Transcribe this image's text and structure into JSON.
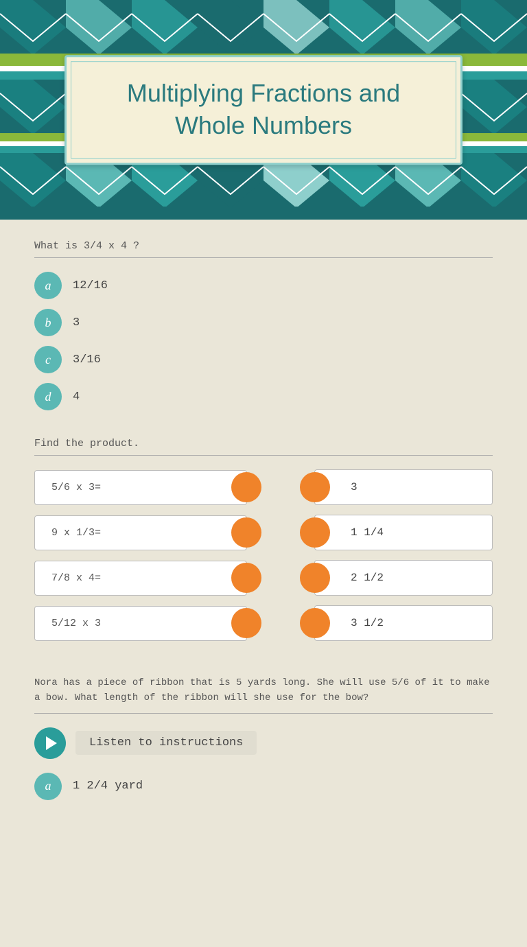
{
  "header": {
    "title_line1": "Multiplying Fractions and",
    "title_line2": "Whole Numbers"
  },
  "question1": {
    "prompt": "What is 3/4 x 4 ?",
    "options": [
      {
        "letter": "a",
        "value": "12/16"
      },
      {
        "letter": "b",
        "value": "3"
      },
      {
        "letter": "c",
        "value": "3/16"
      },
      {
        "letter": "d",
        "value": "4"
      }
    ]
  },
  "question2": {
    "prompt": "Find the product.",
    "pairs": [
      {
        "problem": "5/6 x 3=",
        "answer": "3"
      },
      {
        "problem": "9 x 1/3=",
        "answer": "1 1/4"
      },
      {
        "problem": "7/8 x 4=",
        "answer": "2 1/2"
      },
      {
        "problem": "5/12 x 3",
        "answer": "3 1/2"
      }
    ]
  },
  "question3": {
    "prompt": "Nora has a piece of ribbon that is 5 yards long. She will use 5/6 of it to make a bow. What length of the ribbon will she use for the bow?",
    "listen_label": "Listen to instructions",
    "answer_option": {
      "letter": "a",
      "value": "1 2/4 yard"
    }
  },
  "colors": {
    "teal": "#2a9d9a",
    "orange": "#f0832a",
    "header_bg": "#1a6b6e",
    "card_bg": "#f5f0d8",
    "content_bg": "#eae6d8"
  }
}
